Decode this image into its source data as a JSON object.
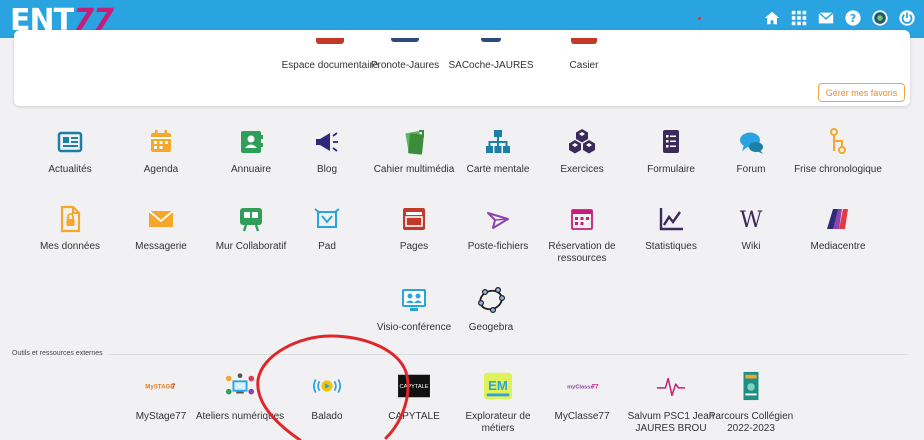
{
  "header": {
    "logo_main": "ENT",
    "logo_num": "77",
    "icons": [
      "home-icon",
      "apps-grid-icon",
      "mail-icon",
      "help-icon",
      "profile-icon",
      "power-icon"
    ]
  },
  "favorites": {
    "items": [
      {
        "label": "Espace documentaire"
      },
      {
        "label": "Pronote-Jaures"
      },
      {
        "label": "SACoche-JAURES"
      },
      {
        "label": "Casier"
      }
    ],
    "manage_button": "Gérer mes favoris"
  },
  "apps": [
    {
      "label": "Actualités",
      "icon": "newspaper-icon",
      "color": "#1b7fa6"
    },
    {
      "label": "Agenda",
      "icon": "calendar-icon",
      "color": "#f4a72a"
    },
    {
      "label": "Annuaire",
      "icon": "contact-book-icon",
      "color": "#2f9e58"
    },
    {
      "label": "Blog",
      "icon": "megaphone-icon",
      "color": "#2d2a7a"
    },
    {
      "label": "Cahier multimédia",
      "icon": "notebook-icon",
      "color": "#5cb85c"
    },
    {
      "label": "Carte mentale",
      "icon": "sitemap-icon",
      "color": "#1b7fa6"
    },
    {
      "label": "Exercices",
      "icon": "cubes-icon",
      "color": "#3b2a5a"
    },
    {
      "label": "Formulaire",
      "icon": "form-icon",
      "color": "#3b2a5a"
    },
    {
      "label": "Forum",
      "icon": "chat-bubbles-icon",
      "color": "#2aa4e0"
    },
    {
      "label": "Frise chronologique",
      "icon": "timeline-icon",
      "color": "#f4a72a"
    },
    {
      "label": "Mes données",
      "icon": "file-lock-icon",
      "color": "#f4a72a"
    },
    {
      "label": "Messagerie",
      "icon": "envelope-icon",
      "color": "#f4a72a"
    },
    {
      "label": "Mur Collaboratif",
      "icon": "board-icon",
      "color": "#2f9e58"
    },
    {
      "label": "Pad",
      "icon": "pad-icon",
      "color": "#2aa4e0"
    },
    {
      "label": "Pages",
      "icon": "page-layout-icon",
      "color": "#c0392b"
    },
    {
      "label": "Poste-fichiers",
      "icon": "paper-plane-icon",
      "color": "#8e44ad"
    },
    {
      "label": "Réservation de ressources",
      "icon": "calendar-grid-icon",
      "color": "#c81e79"
    },
    {
      "label": "Statistiques",
      "icon": "chart-icon",
      "color": "#3b2a5a"
    },
    {
      "label": "Wiki",
      "icon": "wikipedia-icon",
      "color": "#3b2a5a"
    },
    {
      "label": "Mediacentre",
      "icon": "mediacentre-icon",
      "color": "#e63946"
    },
    {
      "label": "Visio-conférence",
      "icon": "video-conference-icon",
      "color": "#2aa4e0"
    },
    {
      "label": "Geogebra",
      "icon": "geogebra-icon",
      "color": "#1c1c1c"
    }
  ],
  "external": {
    "section_label": "Outils et ressources externes",
    "items": [
      {
        "label": "MyStage77",
        "icon": "mystage-logo-icon"
      },
      {
        "label": "Ateliers numériques",
        "icon": "workshop-icon"
      },
      {
        "label": "Balado",
        "icon": "balado-play-icon"
      },
      {
        "label": "CAPYTALE",
        "icon": "capytale-logo-icon",
        "logo_text": "CAPYTALE"
      },
      {
        "label": "Explorateur de métiers",
        "icon": "explorateur-logo-icon"
      },
      {
        "label": "MyClasse77",
        "icon": "myclasse-logo-icon"
      },
      {
        "label": "Salvum PSC1 Jean JAURES BROU",
        "icon": "pulse-icon"
      },
      {
        "label": "Parcours Collégien 2022-2023",
        "icon": "book-cover-icon"
      }
    ]
  }
}
